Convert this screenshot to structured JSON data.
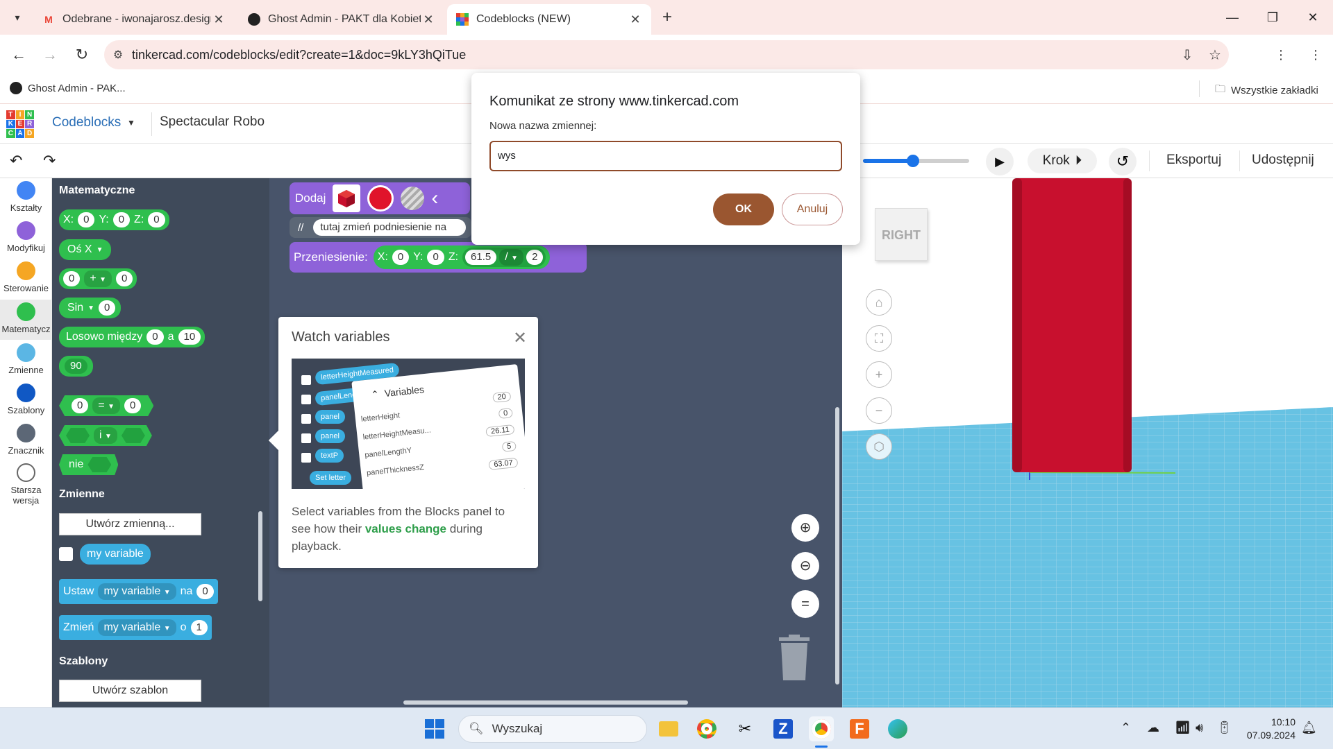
{
  "browser": {
    "tabs": [
      {
        "title": "Odebrane - iwonajarosz.design",
        "favicon": "gmail-icon"
      },
      {
        "title": "Ghost Admin - PAKT dla Kobiet",
        "favicon": "ghost-icon"
      },
      {
        "title": "Codeblocks (NEW)",
        "favicon": "tinkercad-icon",
        "active": true
      }
    ],
    "url": "tinkercad.com/codeblocks/edit?create=1&doc=9kLY3hQiTue",
    "bookmarks": [
      {
        "label": "Ghost Admin - PAK..."
      }
    ],
    "all_bookmarks_label": "Wszystkie zakładki"
  },
  "app": {
    "logo_letters": [
      "T",
      "I",
      "N",
      "K",
      "E",
      "R",
      "C",
      "A",
      "D"
    ],
    "name": "Codeblocks",
    "project_title": "Spectacular Robo",
    "toolbar": {
      "step_label": "Krok",
      "export_label": "Eksportuj",
      "share_label": "Udostępnij",
      "speed_value": 0.47
    }
  },
  "categories": [
    {
      "label": "Kształty",
      "color": "#4285f4"
    },
    {
      "label": "Modyfikuj",
      "color": "#8e62d9"
    },
    {
      "label": "Sterowanie",
      "color": "#f5a623"
    },
    {
      "label": "Matematycz",
      "color": "#2fbf4e",
      "selected": true
    },
    {
      "label": "Zmienne",
      "color": "#5bb6e4"
    },
    {
      "label": "Szablony",
      "color": "#1058c4"
    },
    {
      "label": "Znacznik",
      "color": "#5c6776"
    },
    {
      "label": "Starsza wersja",
      "color": "#ffffff"
    }
  ],
  "flyout": {
    "math_heading": "Matematyczne",
    "xyz": {
      "x_label": "X:",
      "x": "0",
      "y_label": "Y:",
      "y": "0",
      "z_label": "Z:",
      "z": "0"
    },
    "axis_block": "Oś X",
    "arith": {
      "a": "0",
      "op": "+",
      "b": "0"
    },
    "sin": {
      "label": "Sin",
      "value": "0"
    },
    "random": {
      "label": "Losowo między",
      "from": "0",
      "and": "a",
      "to": "10"
    },
    "constant": "90",
    "compare": {
      "a": "0",
      "op": "=",
      "b": "0"
    },
    "logic_and": "i",
    "logic_not": "nie",
    "vars_heading": "Zmienne",
    "create_var_btn": "Utwórz zmienną...",
    "var_name": "my variable",
    "set_block": {
      "label": "Ustaw",
      "var": "my variable",
      "to": "na",
      "value": "0"
    },
    "change_block": {
      "label": "Zmień",
      "var": "my variable",
      "by": "o",
      "value": "1"
    },
    "templates_heading": "Szablony",
    "create_template_btn": "Utwórz szablon"
  },
  "workspace": {
    "add_label": "Dodaj",
    "comment_prefix": "//",
    "comment_text": "tutaj zmień podniesienie na",
    "move_block": {
      "label": "Przeniesienie:",
      "x_label": "X:",
      "x": "0",
      "y_label": "Y:",
      "y": "0",
      "z_label": "Z:",
      "z": "61.5",
      "op": "/",
      "divisor": "2"
    }
  },
  "watch_popup": {
    "title": "Watch variables",
    "text_before": "Select variables from the Blocks panel to see how their ",
    "text_highlight": "values change",
    "text_after": " during playback.",
    "illustration": {
      "panel_title": "Variables",
      "rows": [
        {
          "name": "letterHeight",
          "value": "20"
        },
        {
          "name": "letterHeightMeasu...",
          "value": "0"
        },
        {
          "name": "panelLengthY",
          "value": "26.11"
        },
        {
          "name": "panelThicknessZ",
          "value": "5"
        },
        {
          "name": "",
          "value": "63.07"
        }
      ],
      "pills": [
        "letterHeightMeasured",
        "panelLengthY",
        "panel",
        "panel",
        "textP"
      ],
      "set_label": "Set",
      "set_var": "letter"
    }
  },
  "viewport": {
    "viewcube_label": "RIGHT",
    "object_color": "#c8102e"
  },
  "dialog": {
    "title": "Komunikat ze strony www.tinkercad.com",
    "prompt": "Nowa nazwa zmiennej:",
    "value": "wys",
    "ok_label": "OK",
    "cancel_label": "Anuluj"
  },
  "taskbar": {
    "search_placeholder": "Wyszukaj",
    "time": "10:10",
    "date": "07.09.2024"
  }
}
